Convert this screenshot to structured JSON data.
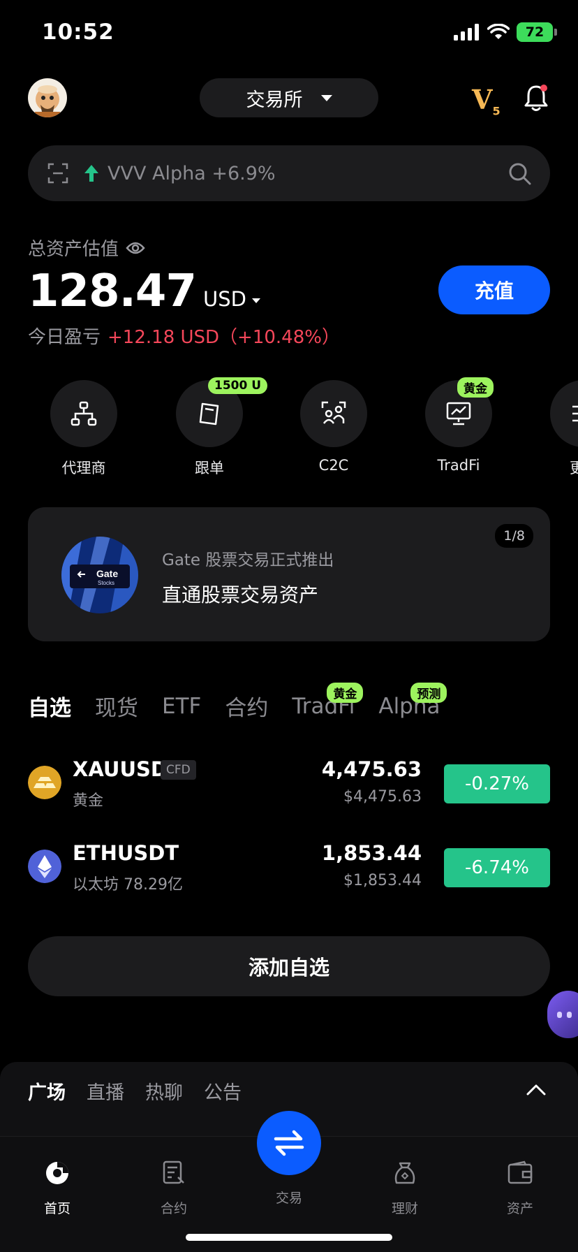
{
  "status_bar": {
    "time": "10:52",
    "battery": "72"
  },
  "header": {
    "exchange_label": "交易所",
    "vip_letter": "V",
    "vip_level": "5"
  },
  "search": {
    "trend_text": "VVV Alpha +6.9%"
  },
  "assets": {
    "label": "总资产估值",
    "value": "128.47",
    "currency": "USD",
    "deposit_label": "充值",
    "pnl_label": "今日盈亏",
    "pnl_value": "+12.18 USD（+10.48%）"
  },
  "shortcuts": [
    {
      "label": "代理商",
      "icon": "org-chart-icon"
    },
    {
      "label": "跟单",
      "icon": "copy-trade-icon",
      "badge": "1500 U"
    },
    {
      "label": "C2C",
      "icon": "c2c-users-icon"
    },
    {
      "label": "TradFi",
      "icon": "chart-board-icon",
      "badge": "黄金"
    },
    {
      "label": "更",
      "icon": "more-icon"
    }
  ],
  "banner": {
    "subtitle": "Gate 股票交易正式推出",
    "title": "直通股票交易资产",
    "page": "1/8",
    "logo_text": "Gate",
    "logo_sub": "Stocks"
  },
  "market_tabs": [
    {
      "label": "自选",
      "active": true
    },
    {
      "label": "现货"
    },
    {
      "label": "ETF"
    },
    {
      "label": "合约"
    },
    {
      "label": "TradFi",
      "badge": "黄金"
    },
    {
      "label": "Alpha",
      "badge": "预测"
    }
  ],
  "watchlist": [
    {
      "symbol": "XAUUSD",
      "tag": "CFD",
      "name": "黄金",
      "price": "4,475.63",
      "fiat": "$4,475.63",
      "change": "-0.27%",
      "icon": "gold-bars-icon"
    },
    {
      "symbol": "ETHUSDT",
      "name": "以太坊 78.29亿",
      "price": "1,853.44",
      "fiat": "$1,853.44",
      "change": "-6.74%",
      "icon": "ethereum-icon"
    }
  ],
  "add_watchlist_label": "添加自选",
  "community_tabs": [
    {
      "label": "广场",
      "active": true
    },
    {
      "label": "直播"
    },
    {
      "label": "热聊"
    },
    {
      "label": "公告"
    }
  ],
  "bottom_nav": [
    {
      "label": "首页",
      "active": true
    },
    {
      "label": "合约"
    },
    {
      "label": "交易"
    },
    {
      "label": "理财"
    },
    {
      "label": "资产"
    }
  ],
  "colors": {
    "accent_blue": "#0b5cff",
    "up_red": "#f5475a",
    "change_green": "#25c48a",
    "badge_green": "#9df35e",
    "vip_gold": "#f7b955"
  }
}
